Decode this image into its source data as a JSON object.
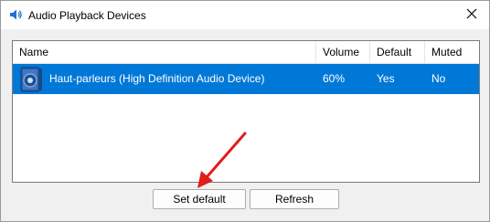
{
  "window": {
    "title": "Audio Playback Devices",
    "icons": {
      "app": "speaker-icon",
      "close": "close-icon"
    }
  },
  "columns": [
    "Name",
    "Volume",
    "Default",
    "Muted"
  ],
  "devices": [
    {
      "name": "Haut-parleurs (High Definition Audio Device)",
      "volume": "60%",
      "default": "Yes",
      "muted": "No",
      "icon": "speaker-device-icon",
      "selected": true
    }
  ],
  "buttons": {
    "set_default": "Set default",
    "refresh": "Refresh"
  },
  "annotation": {
    "icon": "red-arrow-icon",
    "color": "#e21b1b"
  },
  "colors": {
    "selection": "#0078d7",
    "dialog_bg": "#f0f0f0"
  }
}
